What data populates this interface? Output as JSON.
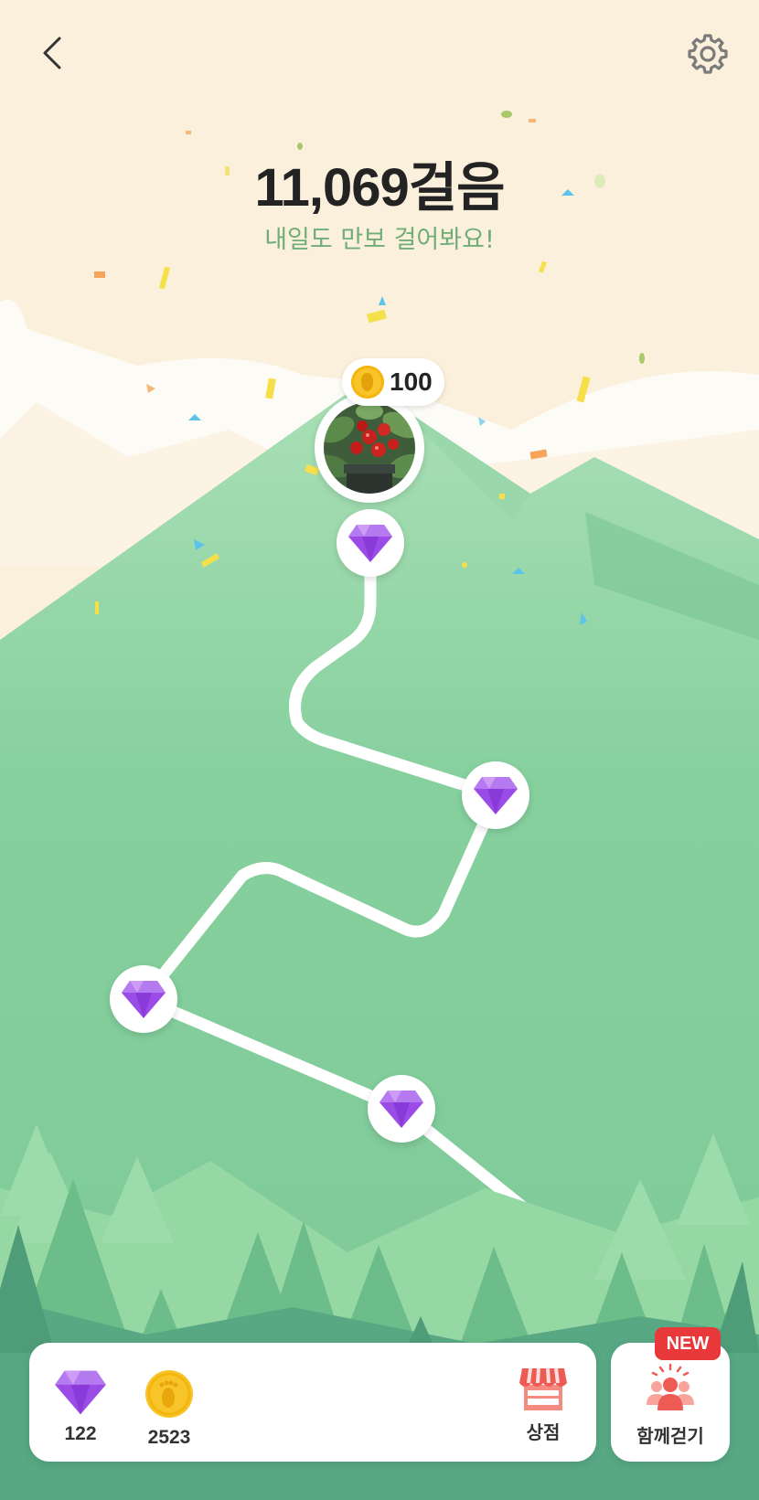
{
  "header": {
    "back_icon": "chevron-left-icon",
    "settings_icon": "gear-icon"
  },
  "summary": {
    "steps_text": "11,069걸음",
    "subtitle": "내일도 만보 걸어봐요!"
  },
  "map": {
    "goal": {
      "reward_amount": "100",
      "reward_icon": "coin-foot-icon",
      "image": "tomato-plant-avatar"
    },
    "nodes": [
      {
        "icon": "purple-gem-icon"
      },
      {
        "icon": "purple-gem-icon"
      },
      {
        "icon": "purple-gem-icon"
      },
      {
        "icon": "purple-gem-icon"
      }
    ]
  },
  "bottom_bar": {
    "gems": {
      "icon": "purple-gem-icon",
      "count": "122"
    },
    "coins": {
      "icon": "coin-foot-icon",
      "count": "2523"
    },
    "shop": {
      "icon": "store-icon",
      "label": "상점"
    },
    "walk_together": {
      "icon": "group-people-icon",
      "label": "함께걷기",
      "badge": "NEW"
    }
  },
  "colors": {
    "sky": "#fbf0dc",
    "mountain": "#7fcc99",
    "forest_dark": "#58a884",
    "subtitle": "#71ad79",
    "gem": "#9c4ce6",
    "coin": "#f7c52a",
    "badge": "#e8383a",
    "shop_red": "#ee5b55"
  }
}
